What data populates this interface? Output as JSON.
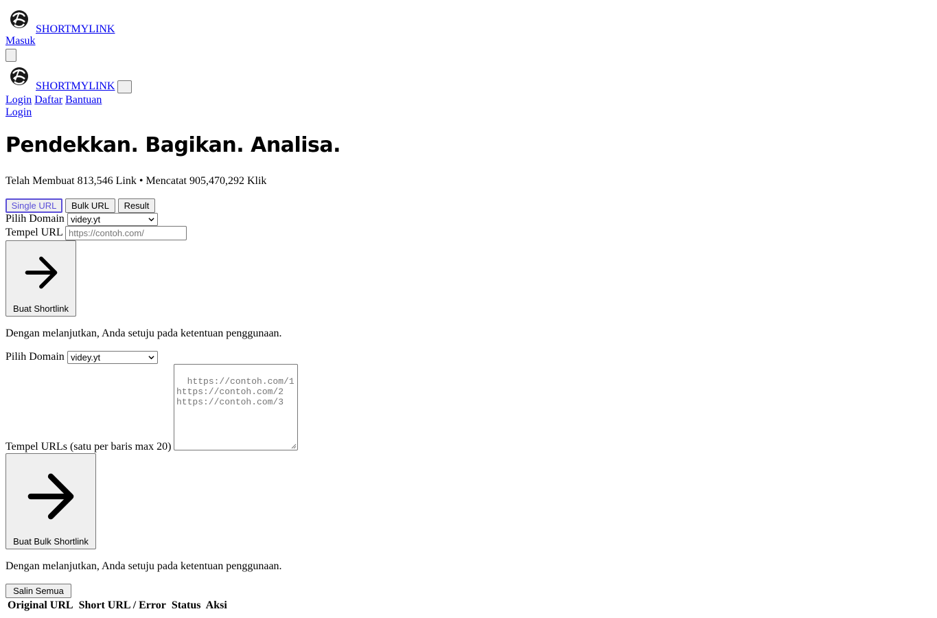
{
  "header": {
    "brand_name": "SHORTMYLINK",
    "masuk_label": "Masuk",
    "menu_toggle_icon": "menu-icon"
  },
  "drawer": {
    "brand_name": "SHORTMYLINK",
    "close_icon_glyph": "",
    "nav": [
      "Login",
      "Daftar",
      "Bantuan"
    ],
    "login_label": "Login"
  },
  "hero": {
    "title": "Pendekkan. Bagikan. Analisa.",
    "stats": "Telah Membuat 813,546 Link • Mencatat 905,470,292 Klik"
  },
  "tabs": [
    {
      "label": "Single URL",
      "active": true
    },
    {
      "label": "Bulk URL",
      "active": false
    },
    {
      "label": "Result",
      "active": false
    }
  ],
  "single": {
    "domain_label": "Pilih Domain",
    "domain_value": "videy.yt",
    "url_label": "Tempel URL",
    "url_placeholder": "https://contoh.com/",
    "submit_label": "Buat Shortlink",
    "terms": "Dengan melanjutkan, Anda setuju pada ketentuan penggunaan."
  },
  "bulk": {
    "domain_label": "Pilih Domain",
    "domain_value": "videy.yt",
    "urls_label": "Tempel URLs (satu per baris max 20)",
    "urls_placeholder": "https://contoh.com/1\nhttps://contoh.com/2\nhttps://contoh.com/3",
    "submit_label": "Buat Bulk Shortlink",
    "terms": "Dengan melanjutkan, Anda setuju pada ketentuan penggunaan."
  },
  "result": {
    "copy_all_label": "Salin Semua",
    "copy_icon_glyph": "",
    "columns": [
      "Original URL",
      "Short URL / Error",
      "Status",
      "Aksi"
    ]
  },
  "colors": {
    "accent": "#5b4fd8",
    "link": "#0000ee"
  }
}
